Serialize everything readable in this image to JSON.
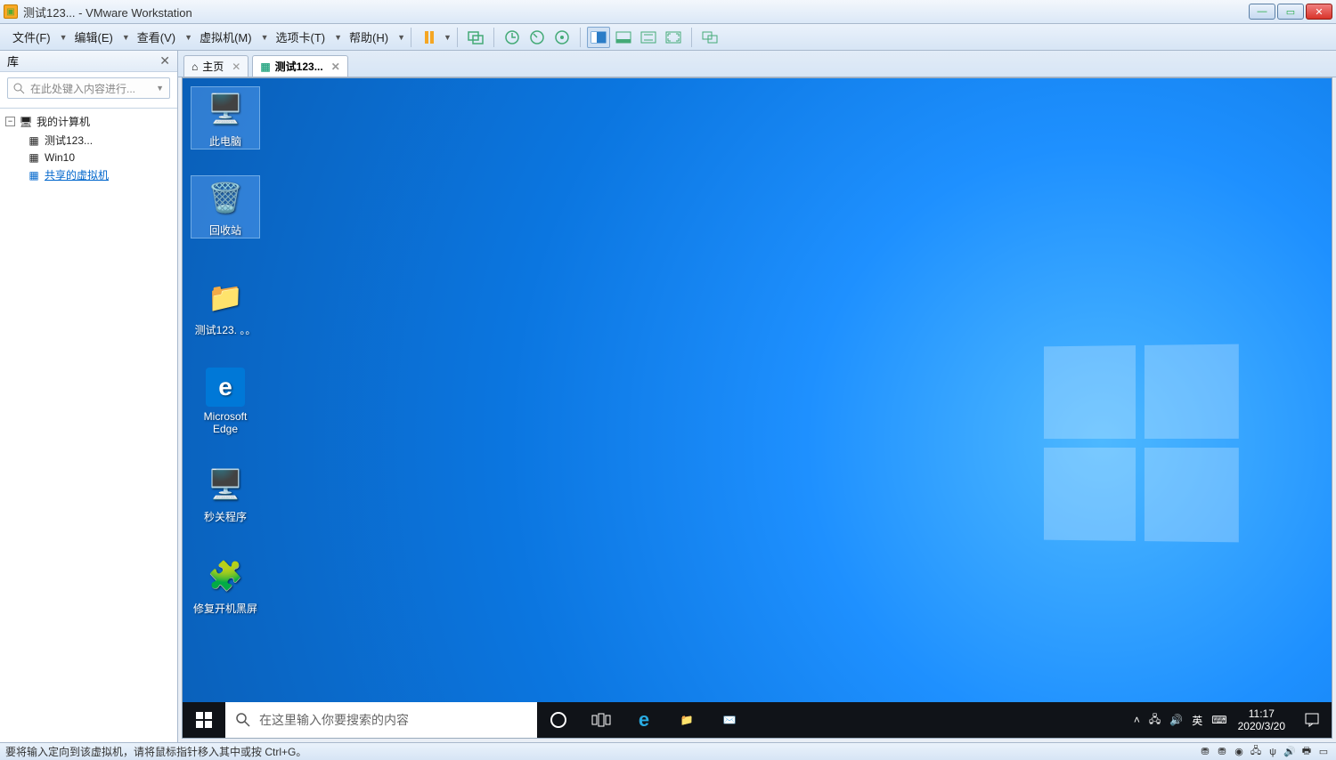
{
  "title": "测试123... - VMware Workstation",
  "menus": {
    "file": "文件(F)",
    "edit": "编辑(E)",
    "view": "查看(V)",
    "vm": "虚拟机(M)",
    "tabs": "选项卡(T)",
    "help": "帮助(H)"
  },
  "sidebar": {
    "header": "库",
    "search_placeholder": "在此处键入内容进行...",
    "root": "我的计算机",
    "items": [
      "测试123...",
      "Win10"
    ],
    "shared": "共享的虚拟机"
  },
  "tabs": {
    "home": "主页",
    "vm": "测试123..."
  },
  "desktop_icons": {
    "pc": "此电脑",
    "recycle": "回收站",
    "folder": "测试123. 。。",
    "edge": "Microsoft Edge",
    "shutdown": "秒关程序",
    "fix": "修复开机黑屏"
  },
  "taskbar": {
    "search_placeholder": "在这里输入你要搜索的内容",
    "ime": "英",
    "time": "11:17",
    "date": "2020/3/20"
  },
  "statusbar": "要将输入定向到该虚拟机，请将鼠标指针移入其中或按 Ctrl+G。"
}
